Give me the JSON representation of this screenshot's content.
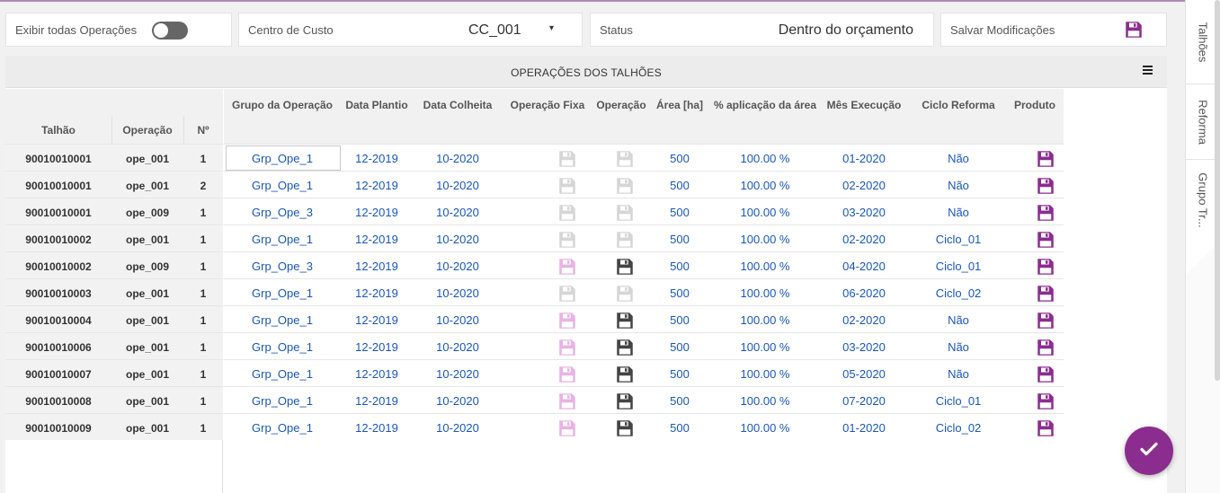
{
  "toolbar": {
    "exibir_label": "Exibir todas Operações",
    "centro_label": "Centro de Custo",
    "centro_value": "CC_001",
    "status_label": "Status",
    "status_value": "Dentro do orçamento",
    "salvar_label": "Salvar Modificações"
  },
  "panel": {
    "title": "OPERAÇÕES DOS TALHÕES"
  },
  "left_headers": {
    "talhao": "Talhão",
    "operacao": "Operação",
    "num": "Nº"
  },
  "main_headers": {
    "grupo": "Grupo da Operação",
    "plantio": "Data Plantio",
    "colheita": "Data Colheita",
    "fixa": "Operação Fixa",
    "operacao": "Operação",
    "area": "Área [ha]",
    "aplicacao": "% aplicação da área",
    "mes": "Mês Execução",
    "ciclo": "Ciclo Reforma",
    "produto": "Produto"
  },
  "rows": [
    {
      "talhao": "90010010001",
      "operacao": "ope_001",
      "num": "1",
      "grupo": "Grp_Ope_1",
      "plantio": "12-2019",
      "colheita": "10-2020",
      "area": "500",
      "aplicacao": "100.00 %",
      "mes": "01-2020",
      "ciclo": "Não",
      "fixa": "off",
      "oper": "off"
    },
    {
      "talhao": "90010010001",
      "operacao": "ope_001",
      "num": "2",
      "grupo": "Grp_Ope_1",
      "plantio": "12-2019",
      "colheita": "10-2020",
      "area": "500",
      "aplicacao": "100.00 %",
      "mes": "02-2020",
      "ciclo": "Não",
      "fixa": "off",
      "oper": "off"
    },
    {
      "talhao": "90010010001",
      "operacao": "ope_009",
      "num": "1",
      "grupo": "Grp_Ope_3",
      "plantio": "12-2019",
      "colheita": "10-2020",
      "area": "500",
      "aplicacao": "100.00 %",
      "mes": "03-2020",
      "ciclo": "Não",
      "fixa": "off",
      "oper": "off"
    },
    {
      "talhao": "90010010002",
      "operacao": "ope_001",
      "num": "1",
      "grupo": "Grp_Ope_1",
      "plantio": "12-2019",
      "colheita": "10-2020",
      "area": "500",
      "aplicacao": "100.00 %",
      "mes": "02-2020",
      "ciclo": "Ciclo_01",
      "fixa": "off",
      "oper": "off"
    },
    {
      "talhao": "90010010002",
      "operacao": "ope_009",
      "num": "1",
      "grupo": "Grp_Ope_3",
      "plantio": "12-2019",
      "colheita": "10-2020",
      "area": "500",
      "aplicacao": "100.00 %",
      "mes": "04-2020",
      "ciclo": "Ciclo_01",
      "fixa": "pink",
      "oper": "dark"
    },
    {
      "talhao": "90010010003",
      "operacao": "ope_001",
      "num": "1",
      "grupo": "Grp_Ope_1",
      "plantio": "12-2019",
      "colheita": "10-2020",
      "area": "500",
      "aplicacao": "100.00 %",
      "mes": "06-2020",
      "ciclo": "Ciclo_02",
      "fixa": "off",
      "oper": "off"
    },
    {
      "talhao": "90010010004",
      "operacao": "ope_001",
      "num": "1",
      "grupo": "Grp_Ope_1",
      "plantio": "12-2019",
      "colheita": "10-2020",
      "area": "500",
      "aplicacao": "100.00 %",
      "mes": "02-2020",
      "ciclo": "Não",
      "fixa": "pink",
      "oper": "dark"
    },
    {
      "talhao": "90010010006",
      "operacao": "ope_001",
      "num": "1",
      "grupo": "Grp_Ope_1",
      "plantio": "12-2019",
      "colheita": "10-2020",
      "area": "500",
      "aplicacao": "100.00 %",
      "mes": "03-2020",
      "ciclo": "Não",
      "fixa": "pink",
      "oper": "dark"
    },
    {
      "talhao": "90010010007",
      "operacao": "ope_001",
      "num": "1",
      "grupo": "Grp_Ope_1",
      "plantio": "12-2019",
      "colheita": "10-2020",
      "area": "500",
      "aplicacao": "100.00 %",
      "mes": "05-2020",
      "ciclo": "Não",
      "fixa": "pink",
      "oper": "dark"
    },
    {
      "talhao": "90010010008",
      "operacao": "ope_001",
      "num": "1",
      "grupo": "Grp_Ope_1",
      "plantio": "12-2019",
      "colheita": "10-2020",
      "area": "500",
      "aplicacao": "100.00 %",
      "mes": "07-2020",
      "ciclo": "Ciclo_01",
      "fixa": "pink",
      "oper": "dark"
    },
    {
      "talhao": "90010010009",
      "operacao": "ope_001",
      "num": "1",
      "grupo": "Grp_Ope_1",
      "plantio": "12-2019",
      "colheita": "10-2020",
      "area": "500",
      "aplicacao": "100.00 %",
      "mes": "01-2020",
      "ciclo": "Ciclo_02",
      "fixa": "pink",
      "oper": "dark"
    }
  ],
  "side_tabs": [
    "Talhões",
    "Reforma",
    "Grupo Tr..."
  ],
  "colors": {
    "accent": "#8b2d8e",
    "link": "#1a56b8",
    "icon_off": "#d6d6d6",
    "icon_pink": "#e7b4e3",
    "icon_dark": "#444444"
  },
  "icons": {
    "save": "floppy-disk-icon",
    "menu": "hamburger-menu-icon",
    "confirm": "check-icon"
  }
}
